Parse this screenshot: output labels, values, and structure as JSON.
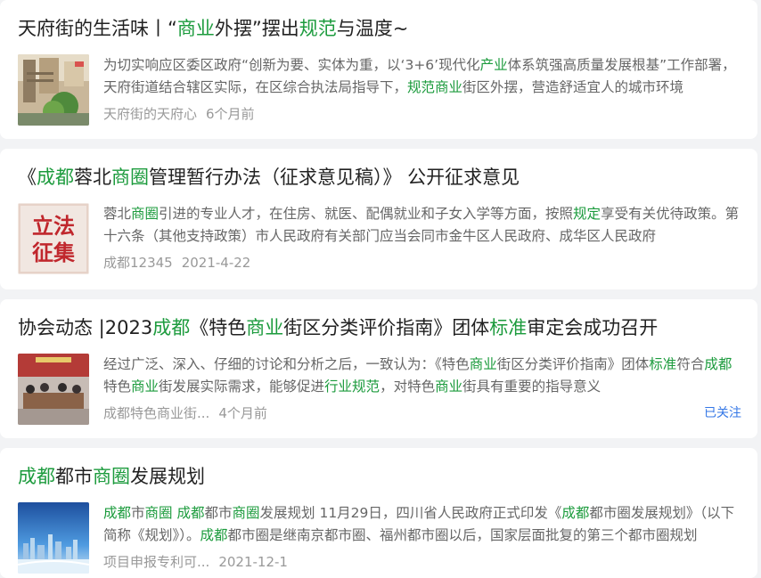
{
  "colors": {
    "highlight": "#1c9b3d",
    "follow": "#3477e6",
    "meta": "#999999",
    "snippet": "#666666",
    "background": "#f2f3f5"
  },
  "articles": [
    {
      "title": [
        {
          "t": "天府街的生活味丨“"
        },
        {
          "t": "商业",
          "hl": true
        },
        {
          "t": "外摆”摆出"
        },
        {
          "t": "规范",
          "hl": true
        },
        {
          "t": "与温度~"
        }
      ],
      "snippet": [
        {
          "t": "为切实响应区委区政府“创新为要、实体为重，以‘3+6’现代化"
        },
        {
          "t": "产业",
          "hl": true
        },
        {
          "t": "体系筑强高质量发展根基”工作部署，天府街道结合辖区实际，在区综合执法局指导下，"
        },
        {
          "t": "规范商业",
          "hl": true
        },
        {
          "t": "街区外摆，营造舒适宜人的城市环境"
        }
      ],
      "source": "天府街的天府心",
      "time": "6个月前",
      "thumbnail": "street-photo-icon"
    },
    {
      "title": [
        {
          "t": "《"
        },
        {
          "t": "成都",
          "hl": true
        },
        {
          "t": "蓉北"
        },
        {
          "t": "商圈",
          "hl": true
        },
        {
          "t": "管理暂行办法（征求意见稿）》 公开征求意见"
        }
      ],
      "snippet": [
        {
          "t": "蓉北"
        },
        {
          "t": "商圈",
          "hl": true
        },
        {
          "t": "引进的专业人才，在住房、就医、配偶就业和子女入学等方面，按照"
        },
        {
          "t": "规定",
          "hl": true
        },
        {
          "t": "享受有关优待政策。第十六条（其他支持政策）市人民政府有关部门应当会同市金牛区人民政府、成华区人民政府"
        }
      ],
      "source": "成都12345",
      "time": "2021-4-22",
      "thumbnail": "legislation-badge-icon",
      "thumbnail_text": [
        "立法",
        "征集"
      ]
    },
    {
      "title": [
        {
          "t": "协会动态 |2023"
        },
        {
          "t": "成都",
          "hl": true
        },
        {
          "t": "《特色"
        },
        {
          "t": "商业",
          "hl": true
        },
        {
          "t": "街区分类评价指南》团体"
        },
        {
          "t": "标准",
          "hl": true
        },
        {
          "t": "审定会成功召开"
        }
      ],
      "snippet": [
        {
          "t": "经过广泛、深入、仔细的讨论和分析之后，一致认为：《特色"
        },
        {
          "t": "商业",
          "hl": true
        },
        {
          "t": "街区分类评价指南》团体"
        },
        {
          "t": "标准",
          "hl": true
        },
        {
          "t": "符合"
        },
        {
          "t": "成都",
          "hl": true
        },
        {
          "t": "特色"
        },
        {
          "t": "商业",
          "hl": true
        },
        {
          "t": "街发展实际需求，能够促进"
        },
        {
          "t": "行业规范",
          "hl": true
        },
        {
          "t": "，对特色"
        },
        {
          "t": "商业",
          "hl": true
        },
        {
          "t": "街具有重要的指导意义"
        }
      ],
      "source": "成都特色商业街...",
      "time": "4个月前",
      "follow_label": "已关注",
      "thumbnail": "meeting-photo-icon"
    },
    {
      "title": [
        {
          "t": "成都",
          "hl": true
        },
        {
          "t": "都市"
        },
        {
          "t": "商圈",
          "hl": true
        },
        {
          "t": "发展规划"
        }
      ],
      "snippet": [
        {
          "t": "成都",
          "hl": true
        },
        {
          "t": "市"
        },
        {
          "t": "商圈",
          "hl": true
        },
        {
          "t": " "
        },
        {
          "t": "成都",
          "hl": true
        },
        {
          "t": "都市"
        },
        {
          "t": "商圈",
          "hl": true
        },
        {
          "t": "发展规划 11月29日，四川省人民政府正式印发《"
        },
        {
          "t": "成都",
          "hl": true
        },
        {
          "t": "都市圈发展规划》（以下简称《规划》）。"
        },
        {
          "t": "成都",
          "hl": true
        },
        {
          "t": "都市圈是继南京都市圈、福州都市圈以后，国家层面批复的第三个都市圈规划"
        }
      ],
      "source": "项目申报专利可...",
      "time": "2021-12-1",
      "thumbnail": "city-skyline-icon"
    }
  ]
}
